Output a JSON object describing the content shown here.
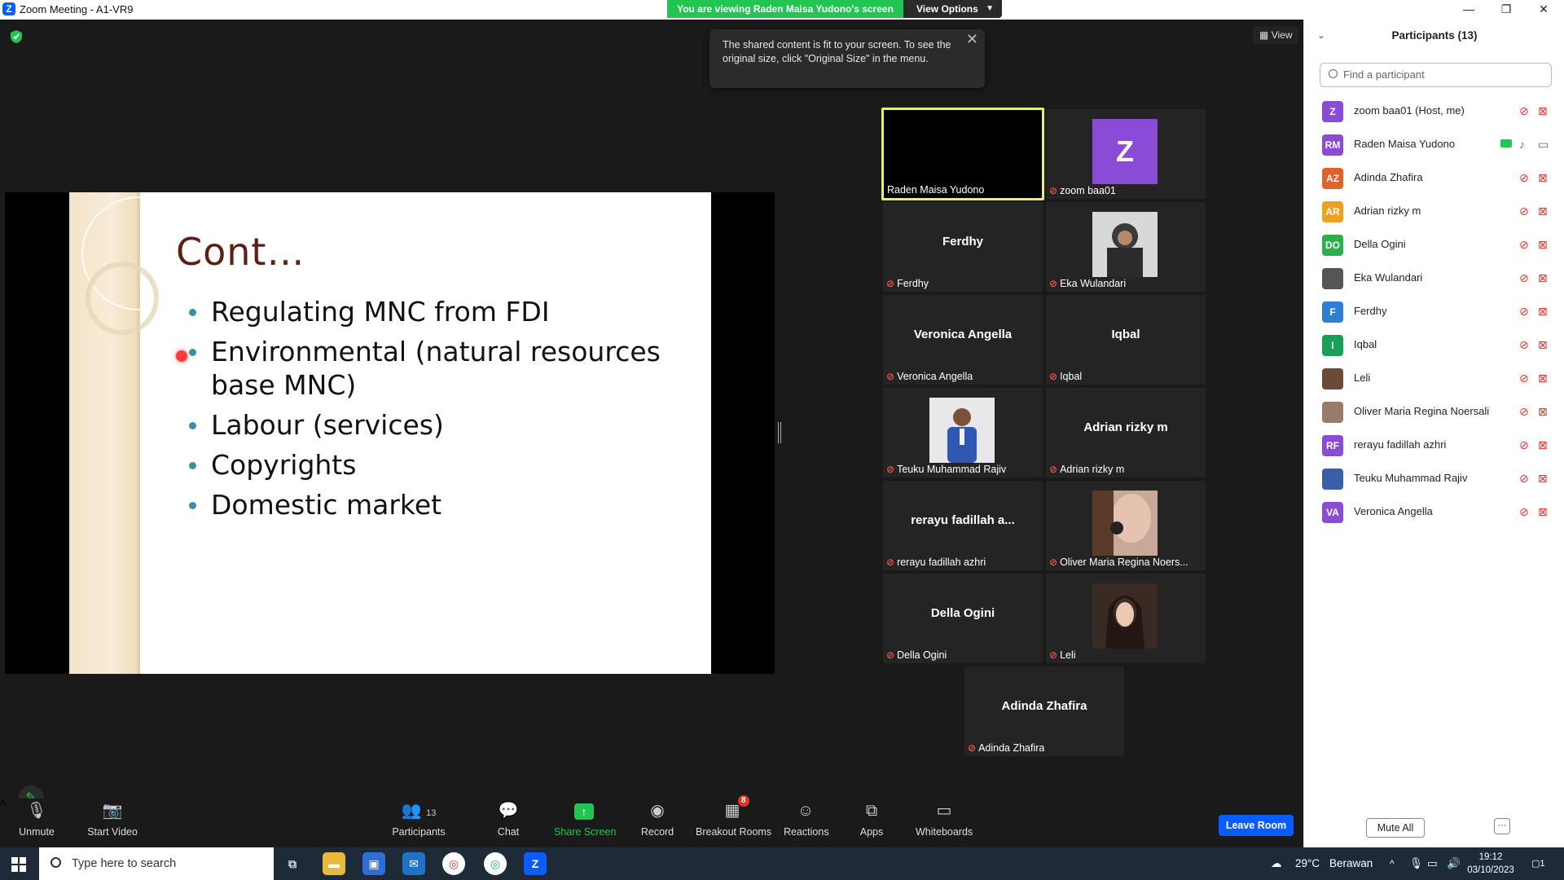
{
  "window": {
    "title": "Zoom Meeting - A1-VR9",
    "minimize": "—",
    "restore": "❐",
    "close": "✕"
  },
  "banner": {
    "viewing_text": "You are viewing Raden Maisa Yudono's screen",
    "view_options": "View Options"
  },
  "view_button": "View",
  "tooltip": {
    "text": "The shared content is fit to your screen. To see the original size, click \"Original Size\" in the menu."
  },
  "slide": {
    "heading": "Cont…",
    "bullets": [
      "Regulating MNC from FDI",
      "Environmental (natural resources base MNC)",
      "Labour (services)",
      "Copyrights",
      "Domestic market"
    ]
  },
  "tiles": [
    {
      "name": "Raden Maisa Yudono",
      "label": "Raden Maisa Yudono",
      "kind": "black-active"
    },
    {
      "name": "zoom baa01",
      "label": "zoom baa01",
      "kind": "avatar",
      "avatar_text": "Z"
    },
    {
      "name": "Ferdhy",
      "label": "Ferdhy",
      "kind": "name"
    },
    {
      "name": "Eka Wulandari",
      "label": "Eka Wulandari",
      "kind": "photo"
    },
    {
      "name": "Veronica Angella",
      "label": "Veronica Angella",
      "kind": "name"
    },
    {
      "name": "Iqbal",
      "label": "Iqbal",
      "kind": "name"
    },
    {
      "name": "Teuku Muhammad Rajiv",
      "label": "Teuku Muhammad Rajiv",
      "kind": "photo"
    },
    {
      "name": "Adrian rizky m",
      "label": "Adrian rizky m",
      "kind": "name"
    },
    {
      "name": "rerayu  fadillah  a...",
      "label": "rerayu fadillah azhri",
      "kind": "name"
    },
    {
      "name": "Oliver Maria Regina Noersali",
      "label": "Oliver Maria Regina Noers...",
      "kind": "photo"
    },
    {
      "name": "Della Ogini",
      "label": "Della Ogini",
      "kind": "name"
    },
    {
      "name": "Leli",
      "label": "Leli",
      "kind": "photo"
    },
    {
      "name": "Adinda Zhafira",
      "label": "Adinda Zhafira",
      "kind": "name"
    }
  ],
  "participants": {
    "header": "Participants (13)",
    "search_placeholder": "Find a participant",
    "list": [
      {
        "initials": "Z",
        "name": "zoom baa01 (Host, me)",
        "color": "#8a4bd6"
      },
      {
        "initials": "RM",
        "name": "Raden Maisa Yudono",
        "color": "#8a4bd6",
        "sharing": true
      },
      {
        "initials": "AZ",
        "name": "Adinda Zhafira",
        "color": "#e0622b"
      },
      {
        "initials": "AR",
        "name": "Adrian rizky m",
        "color": "#f0a020"
      },
      {
        "initials": "DO",
        "name": "Della Ogini",
        "color": "#2db04b"
      },
      {
        "initials": "",
        "name": "Eka Wulandari",
        "color": "#555555",
        "photo": true
      },
      {
        "initials": "F",
        "name": "Ferdhy",
        "color": "#2d7fd6"
      },
      {
        "initials": "I",
        "name": "Iqbal",
        "color": "#18a058"
      },
      {
        "initials": "",
        "name": "Leli",
        "color": "#6b4a3a",
        "photo": true
      },
      {
        "initials": "",
        "name": "Oliver Maria Regina Noersali",
        "color": "#9a7a6a",
        "photo": true
      },
      {
        "initials": "RF",
        "name": "rerayu fadillah azhri",
        "color": "#8a4bd6"
      },
      {
        "initials": "",
        "name": "Teuku Muhammad Rajiv",
        "color": "#3a5fa8",
        "photo": true
      },
      {
        "initials": "VA",
        "name": "Veronica Angella",
        "color": "#8a4bd6"
      }
    ],
    "mute_all": "Mute All",
    "more": "···"
  },
  "toolbar": {
    "unmute": "Unmute",
    "start_video": "Start Video",
    "participants": "Participants",
    "participants_count": "13",
    "chat": "Chat",
    "share_screen": "Share Screen",
    "record": "Record",
    "breakout_rooms": "Breakout Rooms",
    "breakout_badge": "8",
    "reactions": "Reactions",
    "apps": "Apps",
    "whiteboards": "Whiteboards",
    "leave": "Leave Room"
  },
  "taskbar": {
    "search_placeholder": "Type here to search",
    "weather_temp": "29°C",
    "weather_desc": "Berawan",
    "time": "19:12",
    "date": "03/10/2023",
    "notif_count": "1"
  },
  "colors": {
    "zoom_blue": "#0b5cff",
    "share_green": "#23c552",
    "muted_red": "#e0322b",
    "active_speaker": "#e8f06b"
  }
}
